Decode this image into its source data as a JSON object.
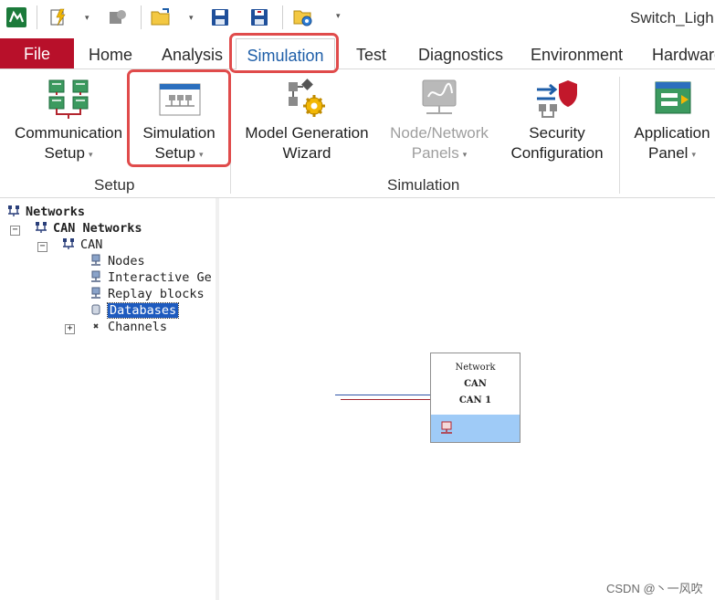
{
  "window": {
    "title": "Switch_Ligh"
  },
  "quick_access": {
    "icons": [
      "app-logo-icon",
      "lightning-doc-icon",
      "record-icon",
      "open-folder-icon",
      "save-icon",
      "save-as-icon",
      "config-icon",
      "customize-icon"
    ]
  },
  "tabs": [
    {
      "label": "File"
    },
    {
      "label": "Home"
    },
    {
      "label": "Analysis"
    },
    {
      "label": "Simulation"
    },
    {
      "label": "Test"
    },
    {
      "label": "Diagnostics"
    },
    {
      "label": "Environment"
    },
    {
      "label": "Hardware"
    }
  ],
  "active_tab": "Simulation",
  "ribbon": {
    "buttons": [
      {
        "line1": "Communication",
        "line2": "Setup",
        "dropdown": true,
        "enabled": true
      },
      {
        "line1": "Simulation",
        "line2": "Setup",
        "dropdown": true,
        "enabled": true
      },
      {
        "line1": "Model Generation",
        "line2": "Wizard",
        "dropdown": false,
        "enabled": true
      },
      {
        "line1": "Node/Network",
        "line2": "Panels",
        "dropdown": true,
        "enabled": false
      },
      {
        "line1": "Security",
        "line2": "Configuration",
        "dropdown": false,
        "enabled": true
      },
      {
        "line1": "Application",
        "line2": "Panel",
        "dropdown": true,
        "enabled": true
      }
    ],
    "groups": [
      {
        "label": "Setup"
      },
      {
        "label": "Simulation"
      }
    ],
    "caret": "▾"
  },
  "tree": {
    "root": "Networks",
    "can_networks": "CAN Networks",
    "can": "CAN",
    "items": [
      "Nodes",
      "Interactive Ge",
      "Replay blocks",
      "Databases",
      "Channels"
    ],
    "selected": "Databases",
    "expanders": {
      "minus": "−",
      "plus": "+"
    }
  },
  "canvas": {
    "network_box": {
      "line1": "Network",
      "line2": "CAN",
      "line3": "CAN 1"
    },
    "bus_colors": {
      "blue": "#2f55a8",
      "red": "#a2242f"
    }
  },
  "watermark": "CSDN @丶一风吹"
}
